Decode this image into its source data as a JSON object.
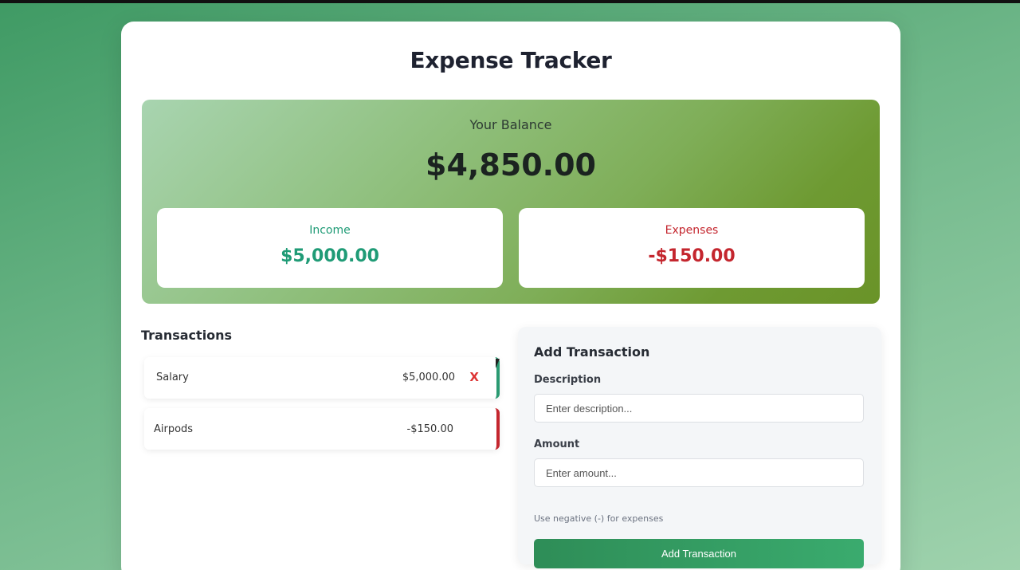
{
  "app": {
    "title": "Expense Tracker"
  },
  "balance": {
    "label": "Your Balance",
    "value": "$4,850.00"
  },
  "summary": {
    "income_label": "Income",
    "income_value": "$5,000.00",
    "expenses_label": "Expenses",
    "expenses_value": "-$150.00"
  },
  "transactions": {
    "heading": "Transactions",
    "items": [
      {
        "description": "Salary",
        "amount": "$5,000.00",
        "delete_label": "X",
        "type": "income"
      },
      {
        "description": "Airpods",
        "amount": "-$150.00",
        "type": "expense"
      }
    ]
  },
  "form": {
    "title": "Add Transaction",
    "description_label": "Description",
    "description_placeholder": "Enter description...",
    "description_value": "",
    "amount_label": "Amount",
    "amount_placeholder": "Enter amount...",
    "amount_value": "",
    "hint": "Use negative (-) for expenses",
    "submit_label": "Add Transaction"
  },
  "colors": {
    "income": "#1f9b76",
    "expense": "#c4262e",
    "button": "#34a065"
  }
}
